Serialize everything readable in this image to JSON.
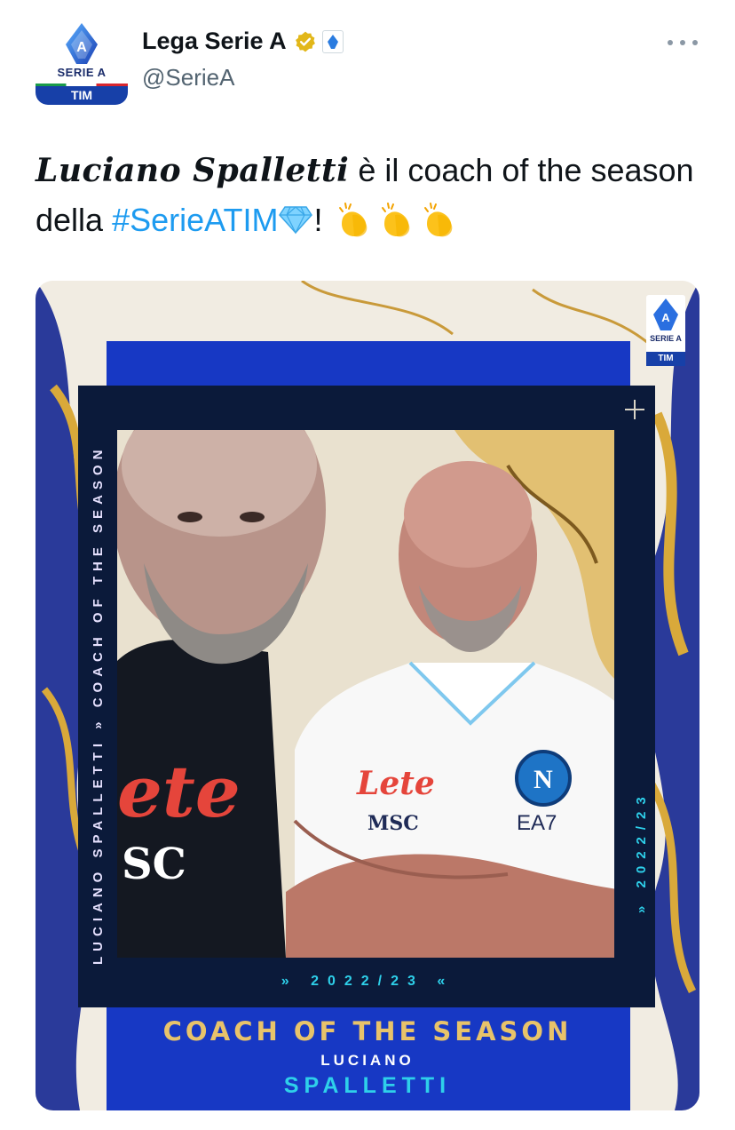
{
  "account": {
    "name": "Lega Serie A",
    "handle": "@SerieA",
    "avatar_serie": "SERIE A",
    "avatar_tim": "TIM",
    "verified_color": "#e2b719"
  },
  "tweet": {
    "name_fancy": "Luciano Spalletti",
    "text_1": " è il coach of the season della ",
    "hashtag": "#SerieATIM",
    "text_2": "! ",
    "hashtag_color": "#1d9bf0",
    "emoji_gem": "gem-stone",
    "emoji_clap": "clapping-hands"
  },
  "media": {
    "vertical_label": "LUCIANO SPALLETTI  »  COACH OF THE SEASON",
    "vertical_season": "»  2022/23",
    "bottom_season": "»  2022/23  «",
    "title": "COACH OF THE SEASON",
    "first_name": "LUCIANO",
    "last_name": "SPALLETTI",
    "logo_serie": "SERIE A",
    "logo_tim": "TIM",
    "shirt_sponsor": "Lete",
    "shirt_sponsor_2": "MSC",
    "shirt_brand": "EA7",
    "shirt_left_sponsor": "ete",
    "shirt_left_msc": "SC",
    "colors": {
      "blue_panel": "#1738c4",
      "cyan": "#2ed0ea",
      "gold": "#e8c36a",
      "dark": "#0b1a3a"
    }
  }
}
